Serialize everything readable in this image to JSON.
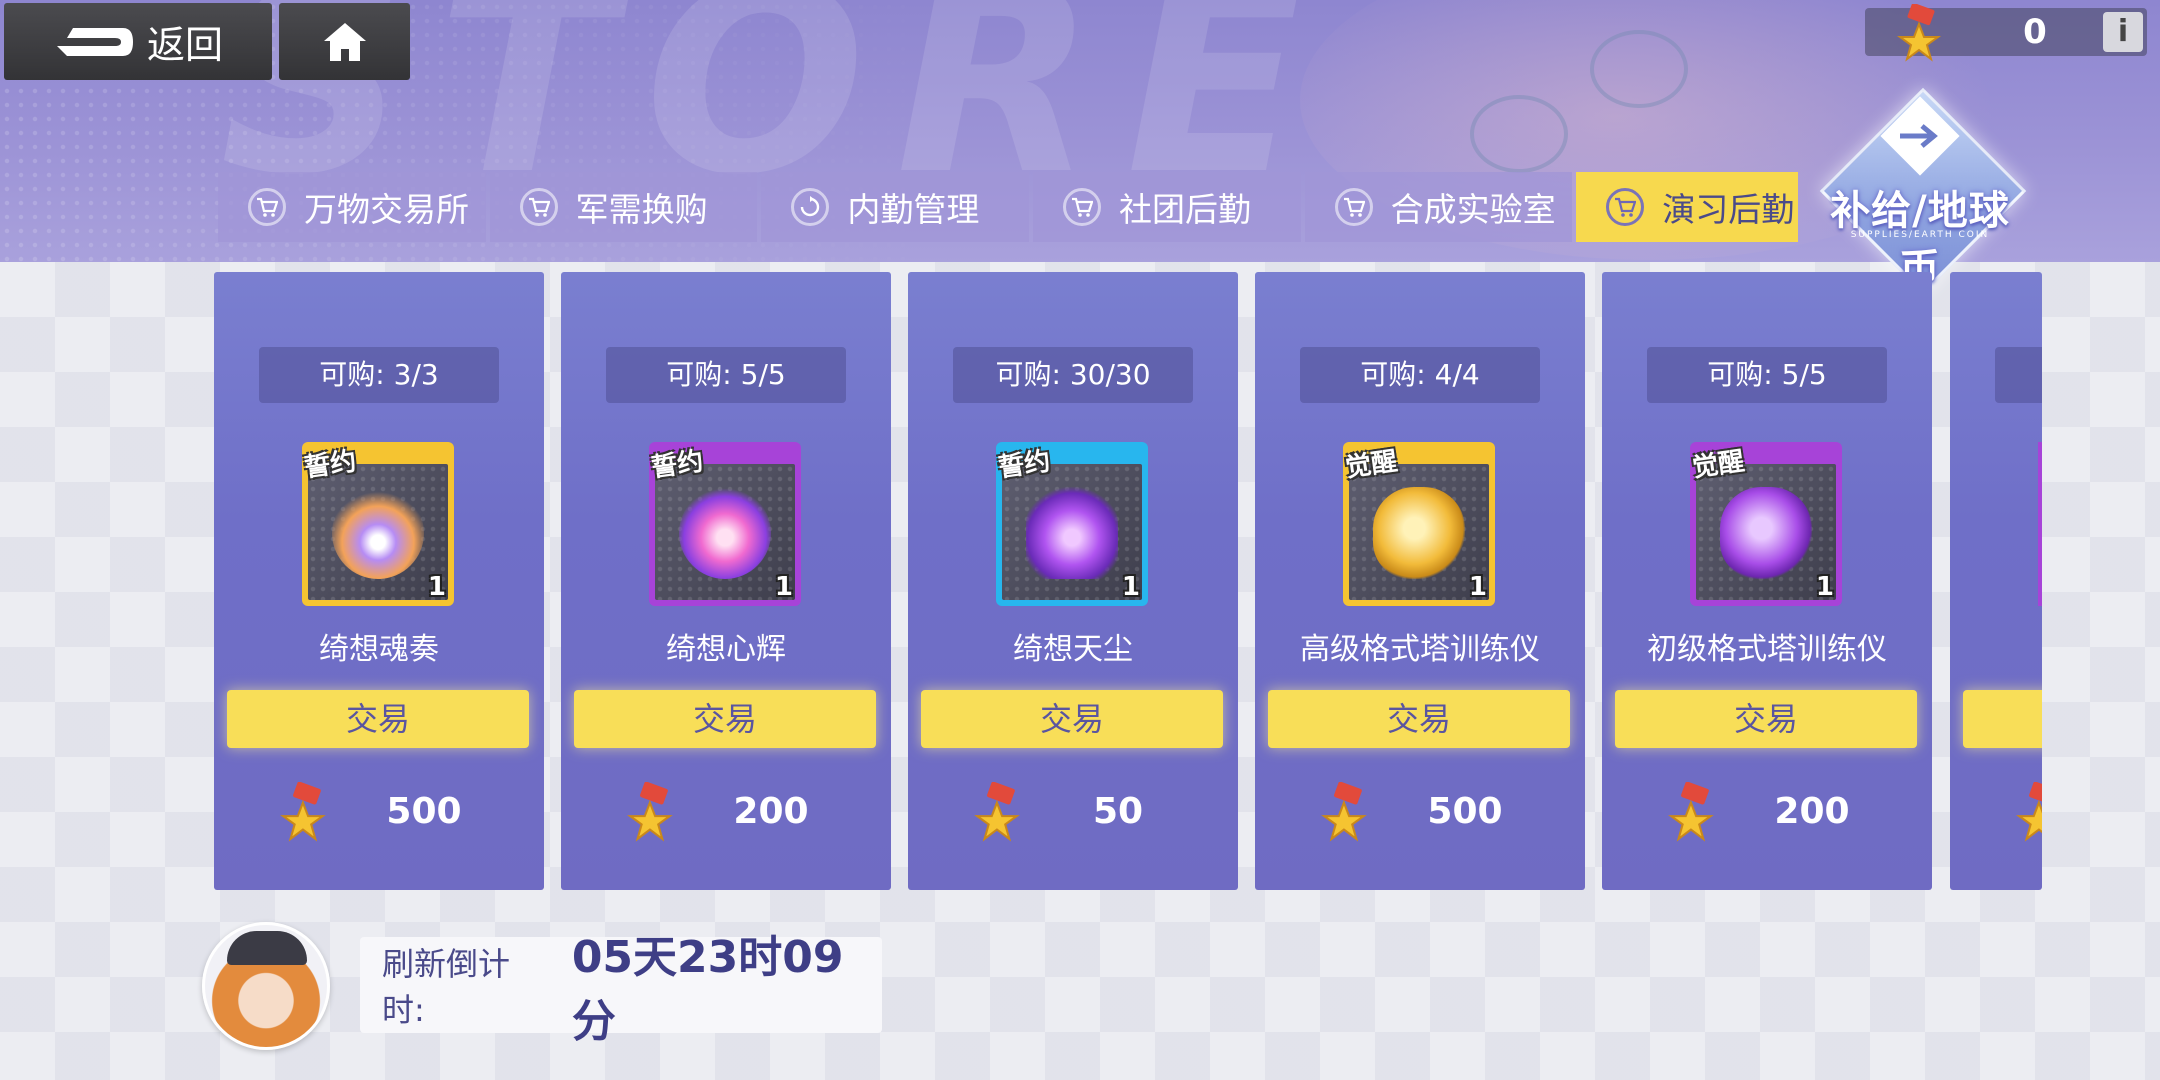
{
  "nav": {
    "back_label": "返回"
  },
  "banner_text": "STORE",
  "currency": {
    "value": "0",
    "info": "i"
  },
  "tabs": [
    {
      "label": "万物交易所"
    },
    {
      "label": "军需换购"
    },
    {
      "label": "内勤管理"
    },
    {
      "label": "社团后勤"
    },
    {
      "label": "合成实验室"
    },
    {
      "label": "演习后勤"
    }
  ],
  "badge": {
    "title": "补给/地球币",
    "subtitle": "SUPPLIES/EARTH COIN"
  },
  "cards": [
    {
      "limit": "可购: 3/3",
      "tag": "誓约",
      "count": "1",
      "name": "绮想魂奏",
      "trade": "交易",
      "price": "500"
    },
    {
      "limit": "可购: 5/5",
      "tag": "誓约",
      "count": "1",
      "name": "绮想心辉",
      "trade": "交易",
      "price": "200"
    },
    {
      "limit": "可购: 30/30",
      "tag": "誓约",
      "count": "1",
      "name": "绮想天尘",
      "trade": "交易",
      "price": "50"
    },
    {
      "limit": "可购: 4/4",
      "tag": "觉醒",
      "count": "1",
      "name": "高级格式塔训练仪",
      "trade": "交易",
      "price": "500"
    },
    {
      "limit": "可购: 5/5",
      "tag": "觉醒",
      "count": "1",
      "name": "初级格式塔训练仪",
      "trade": "交易",
      "price": "200"
    }
  ],
  "refresh": {
    "label": "刷新倒计时:",
    "value": "05天23时09分"
  },
  "colors": {
    "accent": "#f8de58",
    "card": "#7074c8",
    "frame_gold": "#f5c431",
    "frame_purple": "#a743d8",
    "frame_cyan": "#28b6ee"
  }
}
